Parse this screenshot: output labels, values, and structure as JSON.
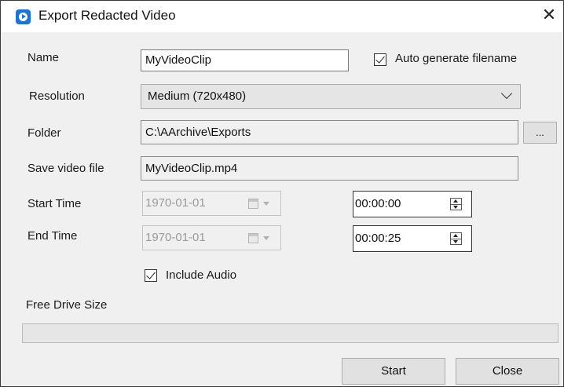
{
  "window": {
    "title": "Export Redacted Video",
    "close_glyph": "✕"
  },
  "labels": {
    "name": "Name",
    "resolution": "Resolution",
    "folder": "Folder",
    "save_file": "Save video file",
    "start_time": "Start Time",
    "end_time": "End Time",
    "free_drive": "Free Drive Size"
  },
  "fields": {
    "name_value": "MyVideoClip",
    "auto_generate_label": "Auto generate filename",
    "auto_generate_checked": true,
    "resolution_value": "Medium (720x480)",
    "folder_value": "C:\\AArchive\\Exports",
    "browse_label": "...",
    "save_file_value": "MyVideoClip.mp4",
    "start_date": "1970-01-01",
    "start_time": "00:00:00",
    "end_date": "1970-01-01",
    "end_time": "00:00:25",
    "include_audio_label": "Include Audio",
    "include_audio_checked": true
  },
  "progress": {
    "value": 0
  },
  "buttons": {
    "start": "Start",
    "close": "Close"
  },
  "icons": {
    "app": "app-play-icon",
    "close": "close-icon",
    "dropdown": "chevron-down-icon",
    "calendar": "calendar-icon",
    "spinner": "spinner-icon"
  },
  "colors": {
    "app_icon": "#1c74d8",
    "window_bg": "#f0f0f0",
    "progress_fill": "#06b025"
  }
}
